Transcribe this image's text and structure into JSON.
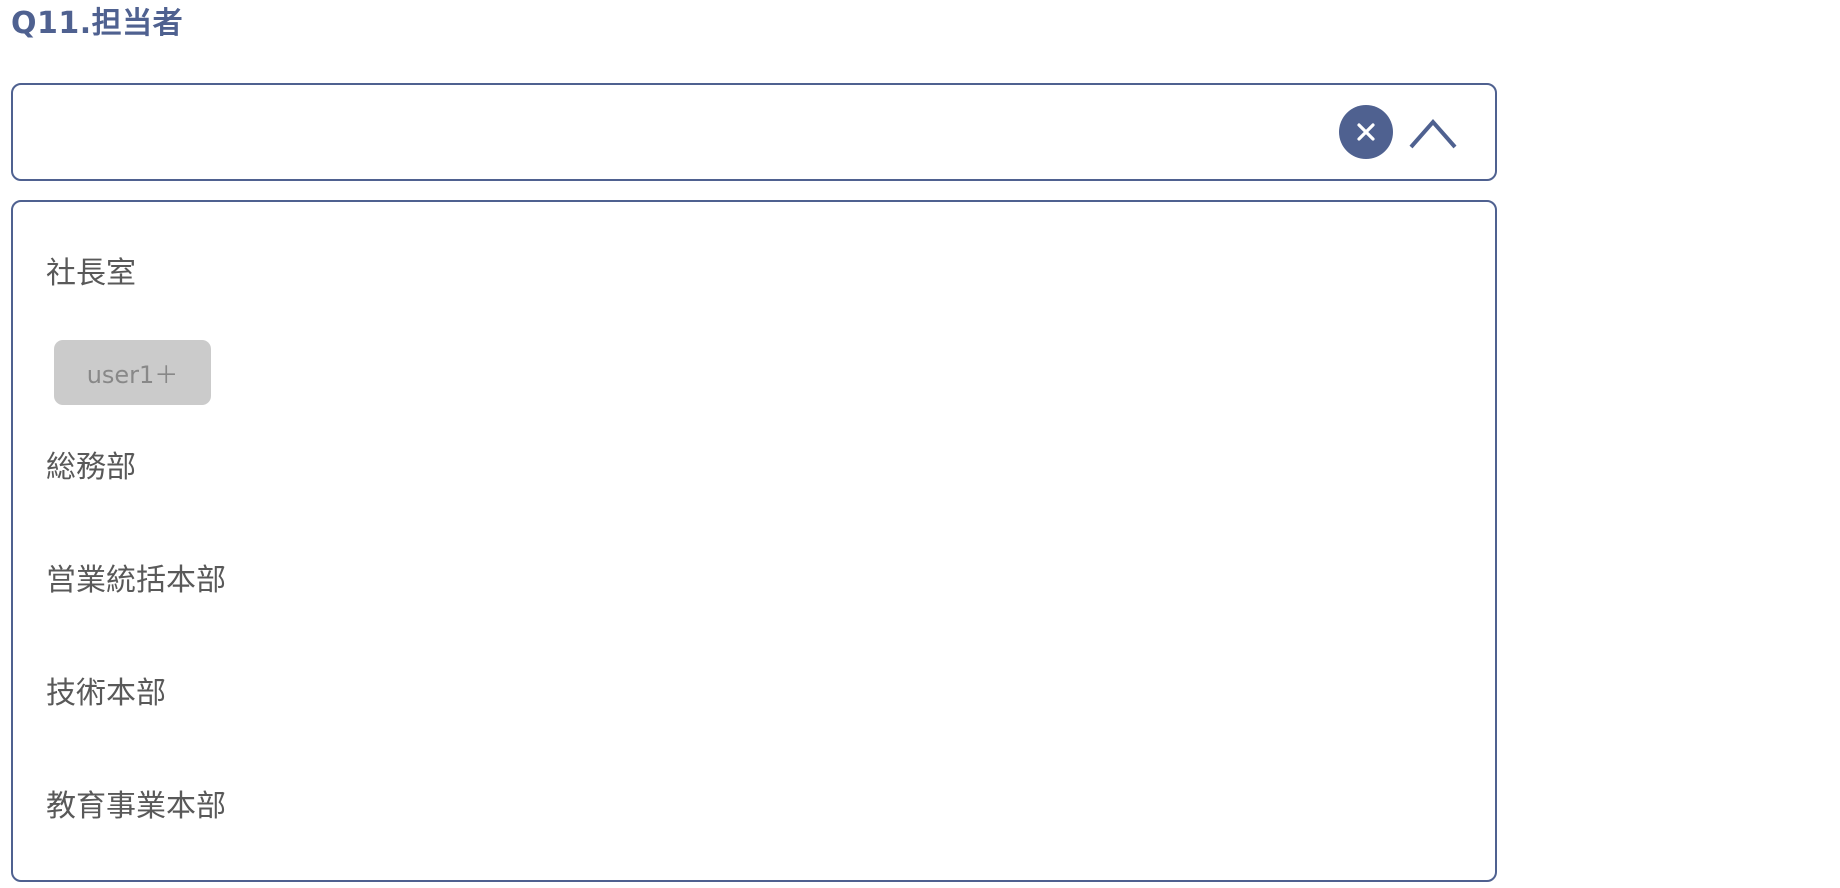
{
  "question": {
    "title": "Q11.担当者"
  },
  "select": {
    "value": "",
    "clear_icon": "close-icon",
    "toggle_icon": "chevron-up-icon",
    "accent_color": "#4f6190"
  },
  "options": {
    "groups": [
      {
        "label": "社長室",
        "users": [
          "user1＋"
        ]
      },
      {
        "label": "総務部",
        "users": []
      },
      {
        "label": "営業統括本部",
        "users": []
      },
      {
        "label": "技術本部",
        "users": []
      },
      {
        "label": "教育事業本部",
        "users": []
      }
    ]
  },
  "colors": {
    "text": "#595959",
    "chip_bg": "#cbcbcb",
    "chip_text": "#888888"
  }
}
